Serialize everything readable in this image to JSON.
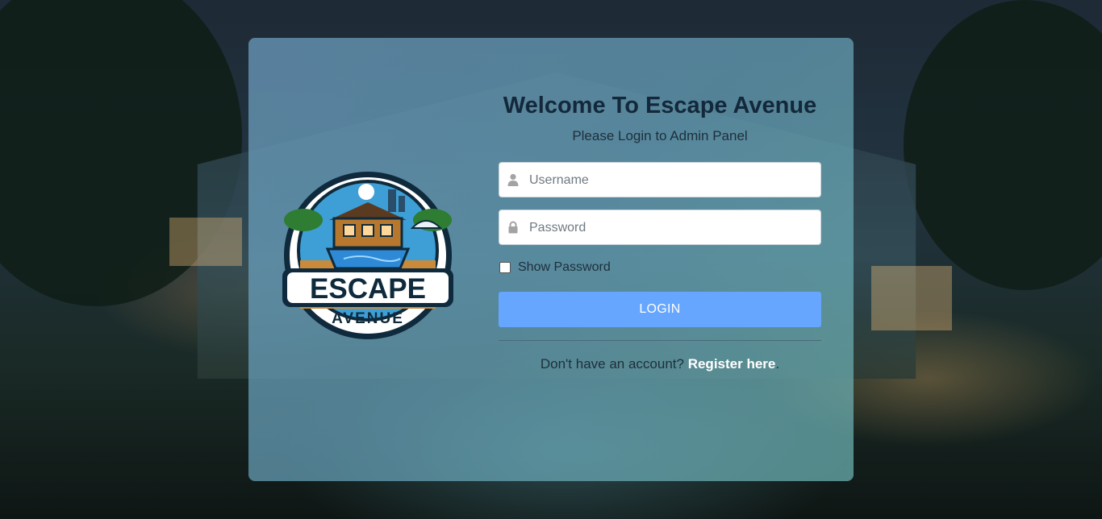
{
  "brand": {
    "logo_text_main": "ESCAPE",
    "logo_text_sub": "AVENUE"
  },
  "login": {
    "title": "Welcome To Escape Avenue",
    "subtitle": "Please Login to Admin Panel",
    "username_placeholder": "Username",
    "username_icon": "user-icon",
    "password_placeholder": "Password",
    "password_icon": "lock-icon",
    "show_password_label": "Show Password",
    "show_password_checked": false,
    "login_button_label": "LOGIN",
    "register_prompt": "Don't have an account?",
    "register_link": "Register here",
    "register_suffix": "."
  },
  "colors": {
    "login_button": "#66a6ff",
    "title_text": "#13283a",
    "card_tint": "#6ea0c3"
  }
}
